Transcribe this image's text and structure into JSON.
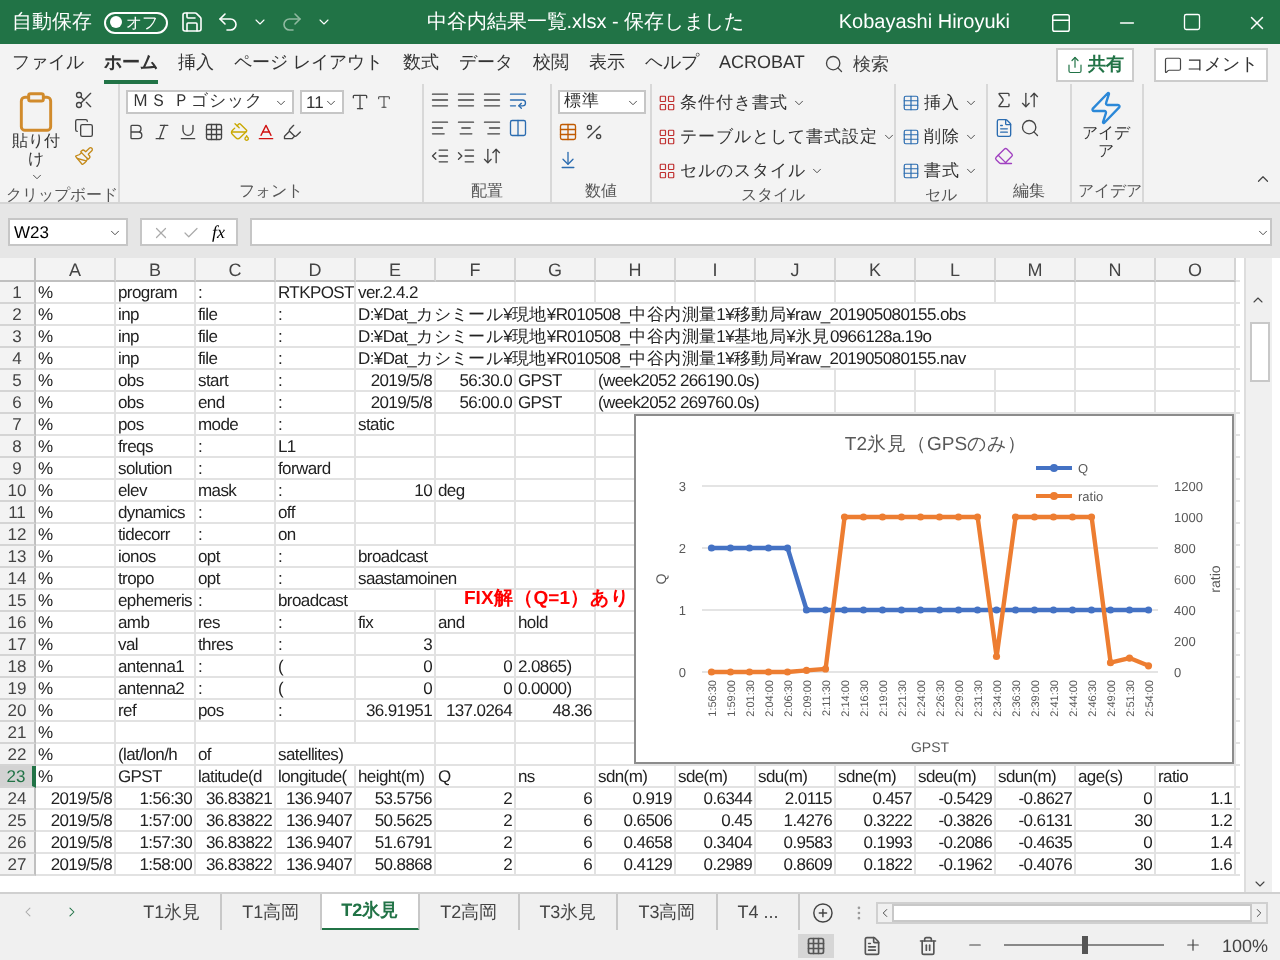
{
  "title_bar": {
    "autosave": {
      "label": "自動保存",
      "state": "オフ",
      "on": false
    },
    "title": "中谷内結果一覧.xlsx  -  保存しました",
    "user": "Kobayashi Hiroyuki"
  },
  "menu_tabs": [
    {
      "label": "ファイル",
      "selected": false
    },
    {
      "label": "ホーム",
      "selected": true
    },
    {
      "label": "挿入",
      "selected": false
    },
    {
      "label": "ページ レイアウト",
      "selected": false
    },
    {
      "label": "数式",
      "selected": false
    },
    {
      "label": "データ",
      "selected": false
    },
    {
      "label": "校閲",
      "selected": false
    },
    {
      "label": "表示",
      "selected": false
    },
    {
      "label": "ヘルプ",
      "selected": false
    },
    {
      "label": "ACROBAT",
      "selected": false
    }
  ],
  "search": {
    "placeholder": "検索"
  },
  "share_button": "共有",
  "comment_button": "コメント",
  "ribbon": {
    "clipboard": {
      "paste": "貼り付け",
      "label": "クリップボード"
    },
    "font": {
      "name": "ＭＳ Ｐゴシック",
      "size": "11",
      "label": "フォント"
    },
    "alignment": {
      "label": "配置"
    },
    "number": {
      "format": "標準",
      "label": "数値"
    },
    "styles": {
      "items": [
        "条件付き書式",
        "テーブルとして書式設定",
        "セルのスタイル"
      ],
      "label": "スタイル"
    },
    "cells": {
      "items": [
        "挿入",
        "削除",
        "書式"
      ],
      "label": "セル"
    },
    "editing": {
      "label": "編集"
    },
    "ideas": {
      "button": "アイデア",
      "label": "アイデア"
    }
  },
  "formula_bar": {
    "name_box": "W23",
    "fx": "fx"
  },
  "sheet": {
    "columns": [
      "A",
      "B",
      "C",
      "D",
      "E",
      "F",
      "G",
      "H",
      "I",
      "J",
      "K",
      "L",
      "M",
      "N",
      "O"
    ],
    "rows": [
      {
        "number": "1",
        "selected": false,
        "cells": [
          {
            "text": "%"
          },
          {
            "text": "program"
          },
          {
            "text": ":"
          },
          {
            "text": "RTKPOST"
          },
          {
            "text": "ver.2.4.2"
          }
        ]
      },
      {
        "number": "2",
        "selected": false,
        "cells": [
          {
            "text": "%"
          },
          {
            "text": "inp"
          },
          {
            "text": "file"
          },
          {
            "text": ":"
          },
          {
            "text": "D:¥Dat_カシミール¥現地¥R010508_中谷内測量1¥移動局¥raw_201905080155.obs"
          }
        ]
      },
      {
        "number": "3",
        "selected": false,
        "cells": [
          {
            "text": "%"
          },
          {
            "text": "inp"
          },
          {
            "text": "file"
          },
          {
            "text": ":"
          },
          {
            "text": "D:¥Dat_カシミール¥現地¥R010508_中谷内測量1¥基地局¥氷見0966128a.19o"
          }
        ]
      },
      {
        "number": "4",
        "selected": false,
        "cells": [
          {
            "text": "%"
          },
          {
            "text": "inp"
          },
          {
            "text": "file"
          },
          {
            "text": ":"
          },
          {
            "text": "D:¥Dat_カシミール¥現地¥R010508_中谷内測量1¥移動局¥raw_201905080155.nav"
          }
        ]
      },
      {
        "number": "5",
        "selected": false,
        "cells": [
          {
            "text": "%"
          },
          {
            "text": "obs"
          },
          {
            "text": "start"
          },
          {
            "text": ":"
          },
          {
            "text": "2019/5/8",
            "kind": "number"
          },
          {
            "text": "56:30.0",
            "kind": "number"
          },
          {
            "text": "GPST"
          },
          {
            "text": "(week2052 266190.0s)"
          }
        ]
      },
      {
        "number": "6",
        "selected": false,
        "cells": [
          {
            "text": "%"
          },
          {
            "text": "obs"
          },
          {
            "text": "end"
          },
          {
            "text": ":"
          },
          {
            "text": "2019/5/8",
            "kind": "number"
          },
          {
            "text": "56:00.0",
            "kind": "number"
          },
          {
            "text": "GPST"
          },
          {
            "text": "(week2052 269760.0s)"
          }
        ]
      },
      {
        "number": "7",
        "selected": false,
        "cells": [
          {
            "text": "%"
          },
          {
            "text": "pos"
          },
          {
            "text": "mode"
          },
          {
            "text": ":"
          },
          {
            "text": "static"
          }
        ]
      },
      {
        "number": "8",
        "selected": false,
        "cells": [
          {
            "text": "%"
          },
          {
            "text": "freqs"
          },
          {
            "text": ":"
          },
          {
            "text": "L1"
          }
        ]
      },
      {
        "number": "9",
        "selected": false,
        "cells": [
          {
            "text": "%"
          },
          {
            "text": "solution"
          },
          {
            "text": ":"
          },
          {
            "text": "forward"
          }
        ]
      },
      {
        "number": "10",
        "selected": false,
        "cells": [
          {
            "text": "%"
          },
          {
            "text": "elev"
          },
          {
            "text": "mask"
          },
          {
            "text": ":"
          },
          {
            "text": "10",
            "kind": "number"
          },
          {
            "text": "deg"
          }
        ]
      },
      {
        "number": "11",
        "selected": false,
        "cells": [
          {
            "text": "%"
          },
          {
            "text": "dynamics"
          },
          {
            "text": ":"
          },
          {
            "text": "off"
          }
        ]
      },
      {
        "number": "12",
        "selected": false,
        "cells": [
          {
            "text": "%"
          },
          {
            "text": "tidecorr"
          },
          {
            "text": ":"
          },
          {
            "text": "on"
          }
        ]
      },
      {
        "number": "13",
        "selected": false,
        "cells": [
          {
            "text": "%"
          },
          {
            "text": "ionos"
          },
          {
            "text": "opt"
          },
          {
            "text": ":"
          },
          {
            "text": "broadcast"
          }
        ]
      },
      {
        "number": "14",
        "selected": false,
        "cells": [
          {
            "text": "%"
          },
          {
            "text": "tropo"
          },
          {
            "text": "opt"
          },
          {
            "text": ":"
          },
          {
            "text": "saastamoinen"
          }
        ]
      },
      {
        "number": "15",
        "selected": false,
        "cells": [
          {
            "text": "%"
          },
          {
            "text": "ephemeris"
          },
          {
            "text": ":"
          },
          {
            "text": "broadcast"
          }
        ]
      },
      {
        "number": "16",
        "selected": false,
        "cells": [
          {
            "text": "%"
          },
          {
            "text": "amb"
          },
          {
            "text": "res"
          },
          {
            "text": ":"
          },
          {
            "text": "fix"
          },
          {
            "text": "and"
          },
          {
            "text": "hold"
          }
        ]
      },
      {
        "number": "17",
        "selected": false,
        "cells": [
          {
            "text": "%"
          },
          {
            "text": "val"
          },
          {
            "text": "thres"
          },
          {
            "text": ":"
          },
          {
            "text": "3",
            "kind": "number"
          }
        ]
      },
      {
        "number": "18",
        "selected": false,
        "cells": [
          {
            "text": "%"
          },
          {
            "text": "antenna1"
          },
          {
            "text": ":"
          },
          {
            "text": "("
          },
          {
            "text": "0",
            "kind": "number"
          },
          {
            "text": "0",
            "kind": "number"
          },
          {
            "text": "2.0865)"
          }
        ]
      },
      {
        "number": "19",
        "selected": false,
        "cells": [
          {
            "text": "%"
          },
          {
            "text": "antenna2"
          },
          {
            "text": ":"
          },
          {
            "text": "("
          },
          {
            "text": "0",
            "kind": "number"
          },
          {
            "text": "0",
            "kind": "number"
          },
          {
            "text": "0.0000)"
          }
        ]
      },
      {
        "number": "20",
        "selected": false,
        "cells": [
          {
            "text": "%"
          },
          {
            "text": "ref"
          },
          {
            "text": "pos"
          },
          {
            "text": ":"
          },
          {
            "text": "36.91951",
            "kind": "number"
          },
          {
            "text": "137.0264",
            "kind": "number"
          },
          {
            "text": "48.36",
            "kind": "number"
          }
        ]
      },
      {
        "number": "21",
        "selected": false,
        "cells": [
          {
            "text": "%"
          }
        ]
      },
      {
        "number": "22",
        "selected": false,
        "cells": [
          {
            "text": "%"
          },
          {
            "text": "(lat/lon/h"
          },
          {
            "text": "of"
          },
          {
            "text": "satellites)"
          }
        ]
      },
      {
        "number": "23",
        "selected": true,
        "cells": [
          {
            "text": "%"
          },
          {
            "text": "GPST"
          },
          {
            "text": "latitude(d"
          },
          {
            "text": "longitude("
          },
          {
            "text": "height(m)"
          },
          {
            "text": "Q"
          },
          {
            "text": "ns"
          },
          {
            "text": "sdn(m)"
          },
          {
            "text": "sde(m)"
          },
          {
            "text": "sdu(m)"
          },
          {
            "text": "sdne(m)"
          },
          {
            "text": "sdeu(m)"
          },
          {
            "text": "sdun(m)"
          },
          {
            "text": "age(s)"
          },
          {
            "text": "ratio"
          }
        ]
      },
      {
        "number": "24",
        "selected": false,
        "cells": [
          {
            "text": "2019/5/8",
            "kind": "number"
          },
          {
            "text": "1:56:30",
            "kind": "number"
          },
          {
            "text": "36.83821",
            "kind": "number"
          },
          {
            "text": "136.9407",
            "kind": "number"
          },
          {
            "text": "53.5756",
            "kind": "number"
          },
          {
            "text": "2",
            "kind": "number"
          },
          {
            "text": "6",
            "kind": "number"
          },
          {
            "text": "0.919",
            "kind": "number"
          },
          {
            "text": "0.6344",
            "kind": "number"
          },
          {
            "text": "2.0115",
            "kind": "number"
          },
          {
            "text": "0.457",
            "kind": "number"
          },
          {
            "text": "-0.5429",
            "kind": "number"
          },
          {
            "text": "-0.8627",
            "kind": "number"
          },
          {
            "text": "0",
            "kind": "number"
          },
          {
            "text": "1.1",
            "kind": "number"
          }
        ]
      },
      {
        "number": "25",
        "selected": false,
        "cells": [
          {
            "text": "2019/5/8",
            "kind": "number"
          },
          {
            "text": "1:57:00",
            "kind": "number"
          },
          {
            "text": "36.83822",
            "kind": "number"
          },
          {
            "text": "136.9407",
            "kind": "number"
          },
          {
            "text": "50.5625",
            "kind": "number"
          },
          {
            "text": "2",
            "kind": "number"
          },
          {
            "text": "6",
            "kind": "number"
          },
          {
            "text": "0.6506",
            "kind": "number"
          },
          {
            "text": "0.45",
            "kind": "number"
          },
          {
            "text": "1.4276",
            "kind": "number"
          },
          {
            "text": "0.3222",
            "kind": "number"
          },
          {
            "text": "-0.3826",
            "kind": "number"
          },
          {
            "text": "-0.6131",
            "kind": "number"
          },
          {
            "text": "30",
            "kind": "number"
          },
          {
            "text": "1.2",
            "kind": "number"
          }
        ]
      },
      {
        "number": "26",
        "selected": false,
        "cells": [
          {
            "text": "2019/5/8",
            "kind": "number"
          },
          {
            "text": "1:57:30",
            "kind": "number"
          },
          {
            "text": "36.83822",
            "kind": "number"
          },
          {
            "text": "136.9407",
            "kind": "number"
          },
          {
            "text": "51.6791",
            "kind": "number"
          },
          {
            "text": "2",
            "kind": "number"
          },
          {
            "text": "6",
            "kind": "number"
          },
          {
            "text": "0.4658",
            "kind": "number"
          },
          {
            "text": "0.3404",
            "kind": "number"
          },
          {
            "text": "0.9583",
            "kind": "number"
          },
          {
            "text": "0.1993",
            "kind": "number"
          },
          {
            "text": "-0.2086",
            "kind": "number"
          },
          {
            "text": "-0.4635",
            "kind": "number"
          },
          {
            "text": "0",
            "kind": "number"
          },
          {
            "text": "1.4",
            "kind": "number"
          }
        ]
      },
      {
        "number": "27",
        "selected": false,
        "cells": [
          {
            "text": "2019/5/8",
            "kind": "number"
          },
          {
            "text": "1:58:00",
            "kind": "number"
          },
          {
            "text": "36.83822",
            "kind": "number"
          },
          {
            "text": "136.9407",
            "kind": "number"
          },
          {
            "text": "50.8868",
            "kind": "number"
          },
          {
            "text": "2",
            "kind": "number"
          },
          {
            "text": "6",
            "kind": "number"
          },
          {
            "text": "0.4129",
            "kind": "number"
          },
          {
            "text": "0.2989",
            "kind": "number"
          },
          {
            "text": "0.8609",
            "kind": "number"
          },
          {
            "text": "0.1822",
            "kind": "number"
          },
          {
            "text": "-0.1962",
            "kind": "number"
          },
          {
            "text": "-0.4076",
            "kind": "number"
          },
          {
            "text": "30",
            "kind": "number"
          },
          {
            "text": "1.6",
            "kind": "number"
          }
        ]
      }
    ],
    "annotation": "FIX解（Q=1）あり",
    "chart": {
      "chart_data": {
        "type": "line",
        "title": "T2氷見（GPSのみ）",
        "xlabel": "GPST",
        "ylabel": "Q",
        "y2label": "ratio",
        "categories": [
          "1:56:30",
          "1:59:00",
          "2:01:30",
          "2:04:00",
          "2:06:30",
          "2:09:00",
          "2:11:30",
          "2:14:00",
          "2:16:30",
          "2:19:00",
          "2:21:30",
          "2:24:00",
          "2:26:30",
          "2:29:00",
          "2:31:30",
          "2:34:00",
          "2:36:30",
          "2:39:00",
          "2:41:30",
          "2:44:00",
          "2:46:30",
          "2:49:00",
          "2:51:30",
          "2:54:00"
        ],
        "legend": "top-right",
        "series": [
          {
            "name": "Q",
            "color": "#4472c4",
            "marker": "circle",
            "values": [
              2,
              2,
              2,
              2,
              2,
              1,
              1,
              1,
              1,
              1,
              1,
              1,
              1,
              1,
              1,
              1,
              1,
              1,
              1,
              1,
              1,
              1,
              1,
              1
            ]
          },
          {
            "name": "ratio",
            "color": "#ed7d31",
            "marker": "circle",
            "axis": "y2",
            "values": [
              0,
              0,
              0,
              0,
              0,
              10,
              20,
              1000,
              1000,
              1000,
              1000,
              1000,
              1000,
              1000,
              1000,
              100,
              1000,
              1000,
              1000,
              1000,
              1000,
              60,
              90,
              40
            ]
          }
        ],
        "ylim": [
          0,
          3
        ],
        "yticks": [
          {
            "value": 0,
            "label": "0"
          },
          {
            "value": 1,
            "label": "1"
          },
          {
            "value": 2,
            "label": "2"
          },
          {
            "value": 3,
            "label": "3"
          }
        ],
        "y2lim": [
          0,
          1200
        ],
        "y2ticks": [
          0,
          200,
          400,
          600,
          800,
          1000,
          1200
        ]
      }
    }
  },
  "sheet_tabs": [
    {
      "label": "T1氷見",
      "selected": false
    },
    {
      "label": "T1高岡",
      "selected": false
    },
    {
      "label": "T2氷見",
      "selected": true
    },
    {
      "label": "T2高岡",
      "selected": false
    },
    {
      "label": "T3氷見",
      "selected": false
    },
    {
      "label": "T3高岡",
      "selected": false
    },
    {
      "label": "T4 ...",
      "selected": false
    }
  ],
  "status_bar": {
    "zoom": "100%",
    "zoom_slider": {
      "level": 0.5
    }
  }
}
